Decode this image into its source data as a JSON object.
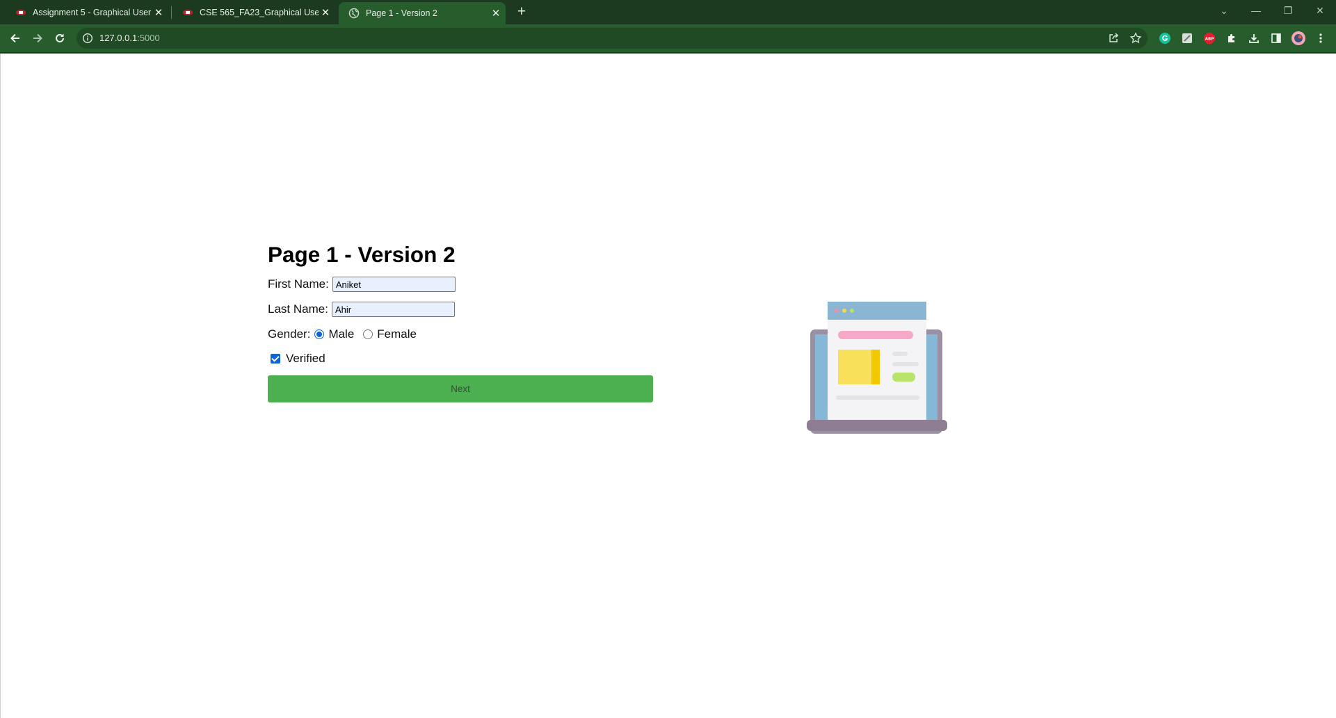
{
  "browser": {
    "tabs": [
      {
        "title": "Assignment 5 - Graphical User Ir"
      },
      {
        "title": "CSE 565_FA23_Graphical User Int"
      },
      {
        "title": "Page 1 - Version 2"
      }
    ],
    "address": {
      "host": "127.0.0.1",
      "port": ":5000"
    }
  },
  "page": {
    "title": "Page 1 - Version 2",
    "first_name": {
      "label": "First Name:",
      "value": "Aniket"
    },
    "last_name": {
      "label": "Last Name:",
      "value": "Ahir"
    },
    "gender": {
      "label": "Gender:",
      "options": [
        "Male",
        "Female"
      ],
      "selected": "Male"
    },
    "verified": {
      "label": "Verified",
      "checked": true
    },
    "next_label": "Next"
  }
}
